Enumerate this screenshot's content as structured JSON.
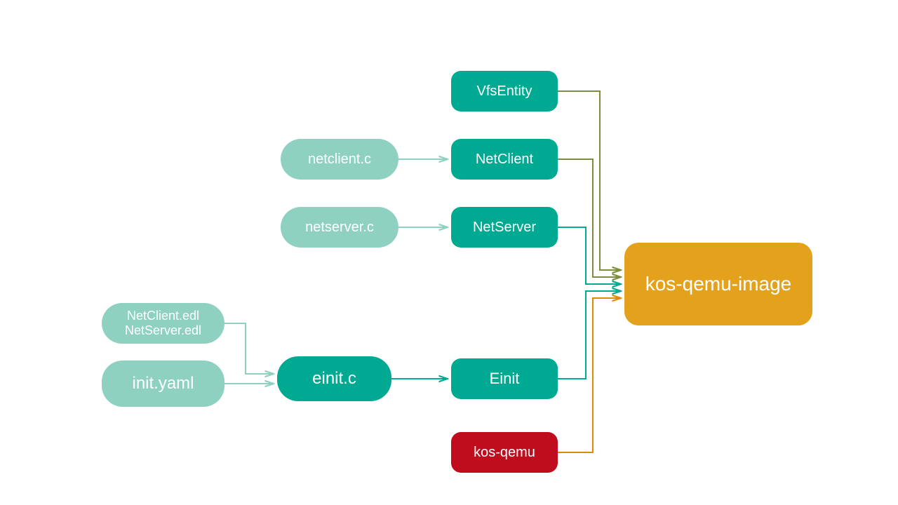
{
  "nodes": {
    "edl": {
      "line1": "NetClient.edl",
      "line2": "NetServer.edl"
    },
    "init_yaml": "init.yaml",
    "netclient_c": "netclient.c",
    "netserver_c": "netserver.c",
    "einit_c": "einit.c",
    "vfsentity": "VfsEntity",
    "netclient": "NetClient",
    "netserver": "NetServer",
    "einit": "Einit",
    "kos_qemu": "kos-qemu",
    "kos_qemu_image": "kos-qemu-image"
  },
  "colors": {
    "light_teal": "#8ed1c1",
    "teal": "#00a991",
    "olive": "#7b8e3e",
    "red": "#c00d1e",
    "orange": "#e4a11b",
    "orange_line": "#e08a00"
  }
}
